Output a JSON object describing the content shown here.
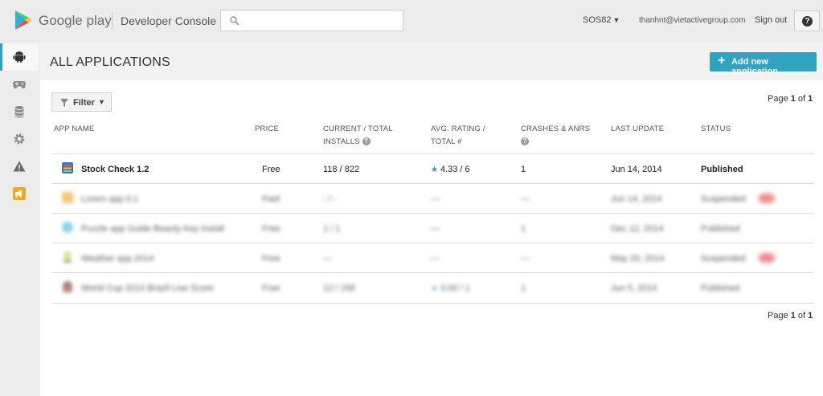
{
  "topbar": {
    "brand": "Google play",
    "console_title": "Developer Console",
    "search_placeholder": "",
    "account": "SOS82",
    "email": "thanhnt@vietactivegroup.com",
    "sign_out": "Sign out",
    "help": "?"
  },
  "leftnav": {
    "items": [
      {
        "icon": "android-icon",
        "active": true
      },
      {
        "icon": "gamepad-icon",
        "active": false
      },
      {
        "icon": "database-icon",
        "active": false
      },
      {
        "icon": "gear-icon",
        "active": false
      },
      {
        "icon": "warning-icon",
        "active": false
      },
      {
        "icon": "announcement-icon",
        "active": false
      }
    ]
  },
  "main": {
    "title": "ALL APPLICATIONS",
    "add_button": "Add new application",
    "filter_label": "Filter",
    "pager_top": {
      "prefix": "Page ",
      "current": "1",
      "of": " of ",
      "total": "1"
    },
    "pager_bottom": {
      "prefix": "Page ",
      "current": "1",
      "of": " of ",
      "total": "1"
    },
    "columns": {
      "app_name": "APP NAME",
      "price": "PRICE",
      "installs_1": "CURRENT / TOTAL",
      "installs_2": "INSTALLS",
      "rating_1": "AVG. RATING /",
      "rating_2": "TOTAL #",
      "crashes_1": "CRASHES & ANRS",
      "last_update": "LAST UPDATE",
      "status": "STATUS"
    },
    "rows": [
      {
        "name": "Stock Check 1.2",
        "price": "Free",
        "installs": "118  /  822",
        "rating": "4.33  /  6",
        "crashes": "1",
        "updated": "Jun 14, 2014",
        "status": "Published",
        "icon_color": "#4a6fb5"
      },
      {
        "name": "Lorem app 0.1",
        "price": "Paid",
        "installs": "- / -",
        "rating": "—",
        "crashes": "—",
        "updated": "Jun 14, 2014",
        "status": "Suspended",
        "icon_color": "#f2b34a"
      },
      {
        "name": "Puzzle app Guide Beauty Key Install",
        "price": "Free",
        "installs": "1  /  1",
        "rating": "—",
        "crashes": "1",
        "updated": "Dec 12, 2014",
        "status": "Published",
        "icon_color": "#5cc7e8"
      },
      {
        "name": "Weather app 2014",
        "price": "Free",
        "installs": "—",
        "rating": "—",
        "crashes": "—",
        "updated": "May 20, 2014",
        "status": "Suspended",
        "icon_color": "#c9d46a"
      },
      {
        "name": "World Cup 2014 Brazil Live Score",
        "price": "Free",
        "installs": "12  /  158",
        "rating": "3.00  /  1",
        "crashes": "1",
        "updated": "Jun 5, 2014",
        "status": "Published",
        "icon_color": "#a55d5d"
      }
    ]
  }
}
